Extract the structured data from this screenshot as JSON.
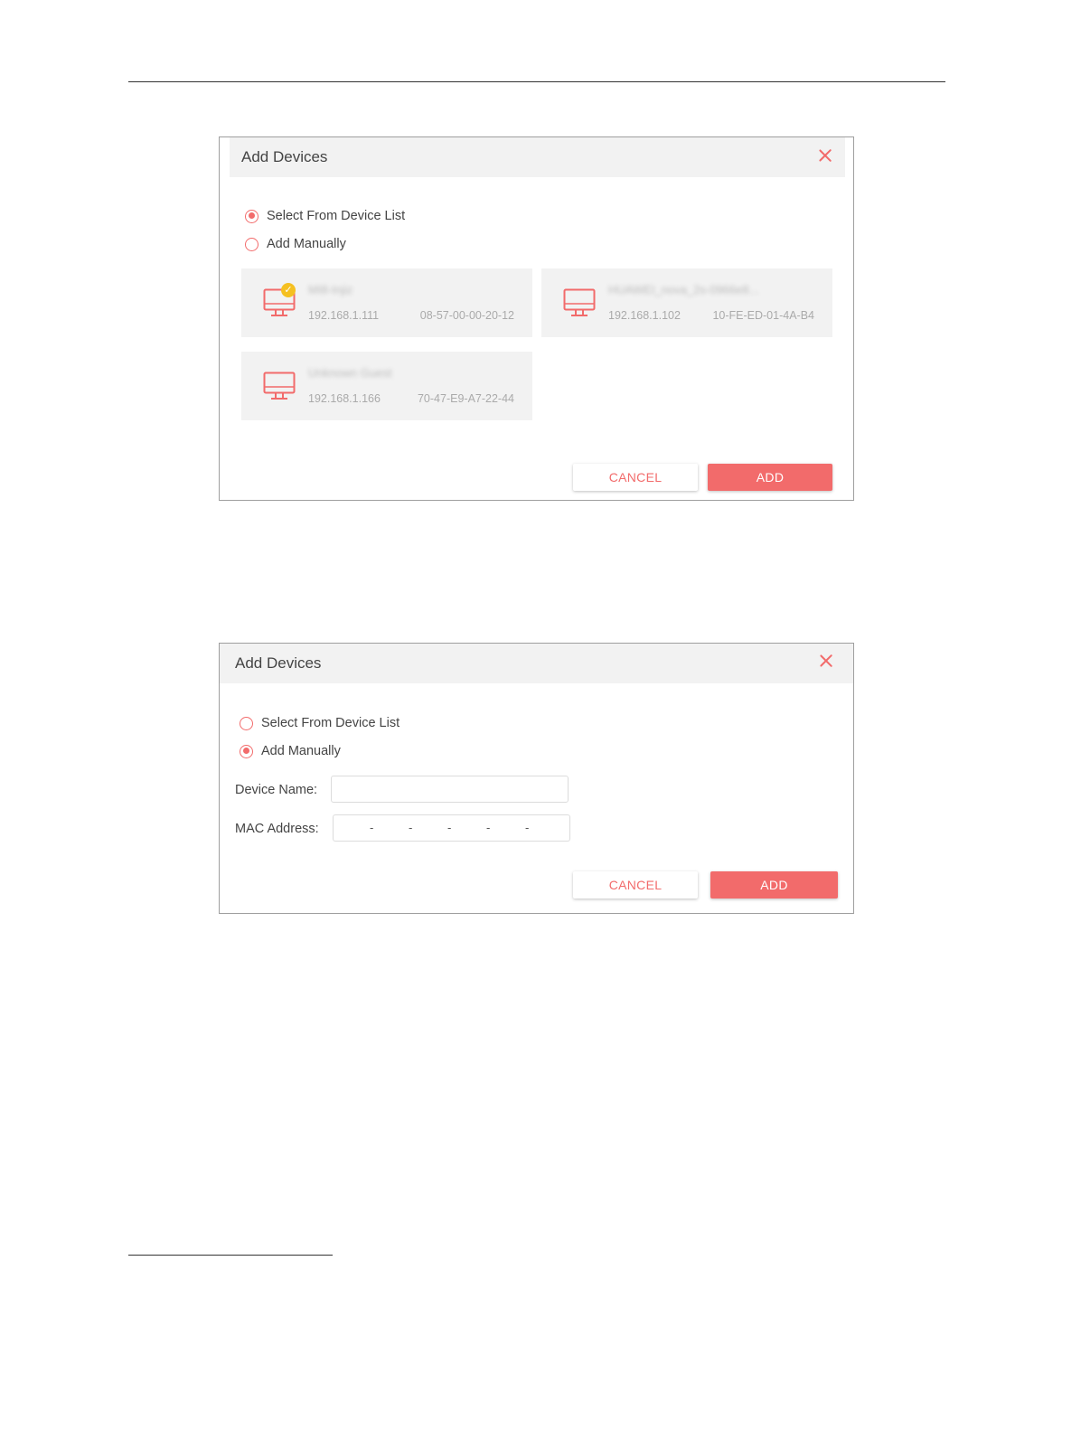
{
  "dialog1": {
    "title": "Add Devices",
    "radio_select_label": "Select From Device List",
    "radio_manual_label": "Add Manually",
    "selected_option": "select",
    "devices": [
      {
        "name": "MI8-Injiz",
        "ip": "192.168.1.111",
        "mac": "08-57-00-00-20-12",
        "badge": "✓",
        "name_blurred": true
      },
      {
        "name": "HUAWEI_nova_2s-0966e8...",
        "ip": "192.168.1.102",
        "mac": "10-FE-ED-01-4A-B4",
        "name_blurred": true
      },
      {
        "name": "Unknown Guest",
        "ip": "192.168.1.166",
        "mac": "70-47-E9-A7-22-44",
        "name_blurred": true
      }
    ],
    "cancel_label": "CANCEL",
    "add_label": "ADD"
  },
  "dialog2": {
    "title": "Add Devices",
    "radio_select_label": "Select From Device List",
    "radio_manual_label": "Add Manually",
    "selected_option": "manual",
    "device_name_label": "Device Name:",
    "device_name_value": "",
    "mac_address_label": "MAC Address:",
    "mac_separator": "-",
    "cancel_label": "CANCEL",
    "add_label": "ADD"
  },
  "colors": {
    "accent": "#f26b6b",
    "badge": "#f5c021",
    "titlebar_bg": "#f2f2f2",
    "card_bg": "#f2f2f2"
  }
}
